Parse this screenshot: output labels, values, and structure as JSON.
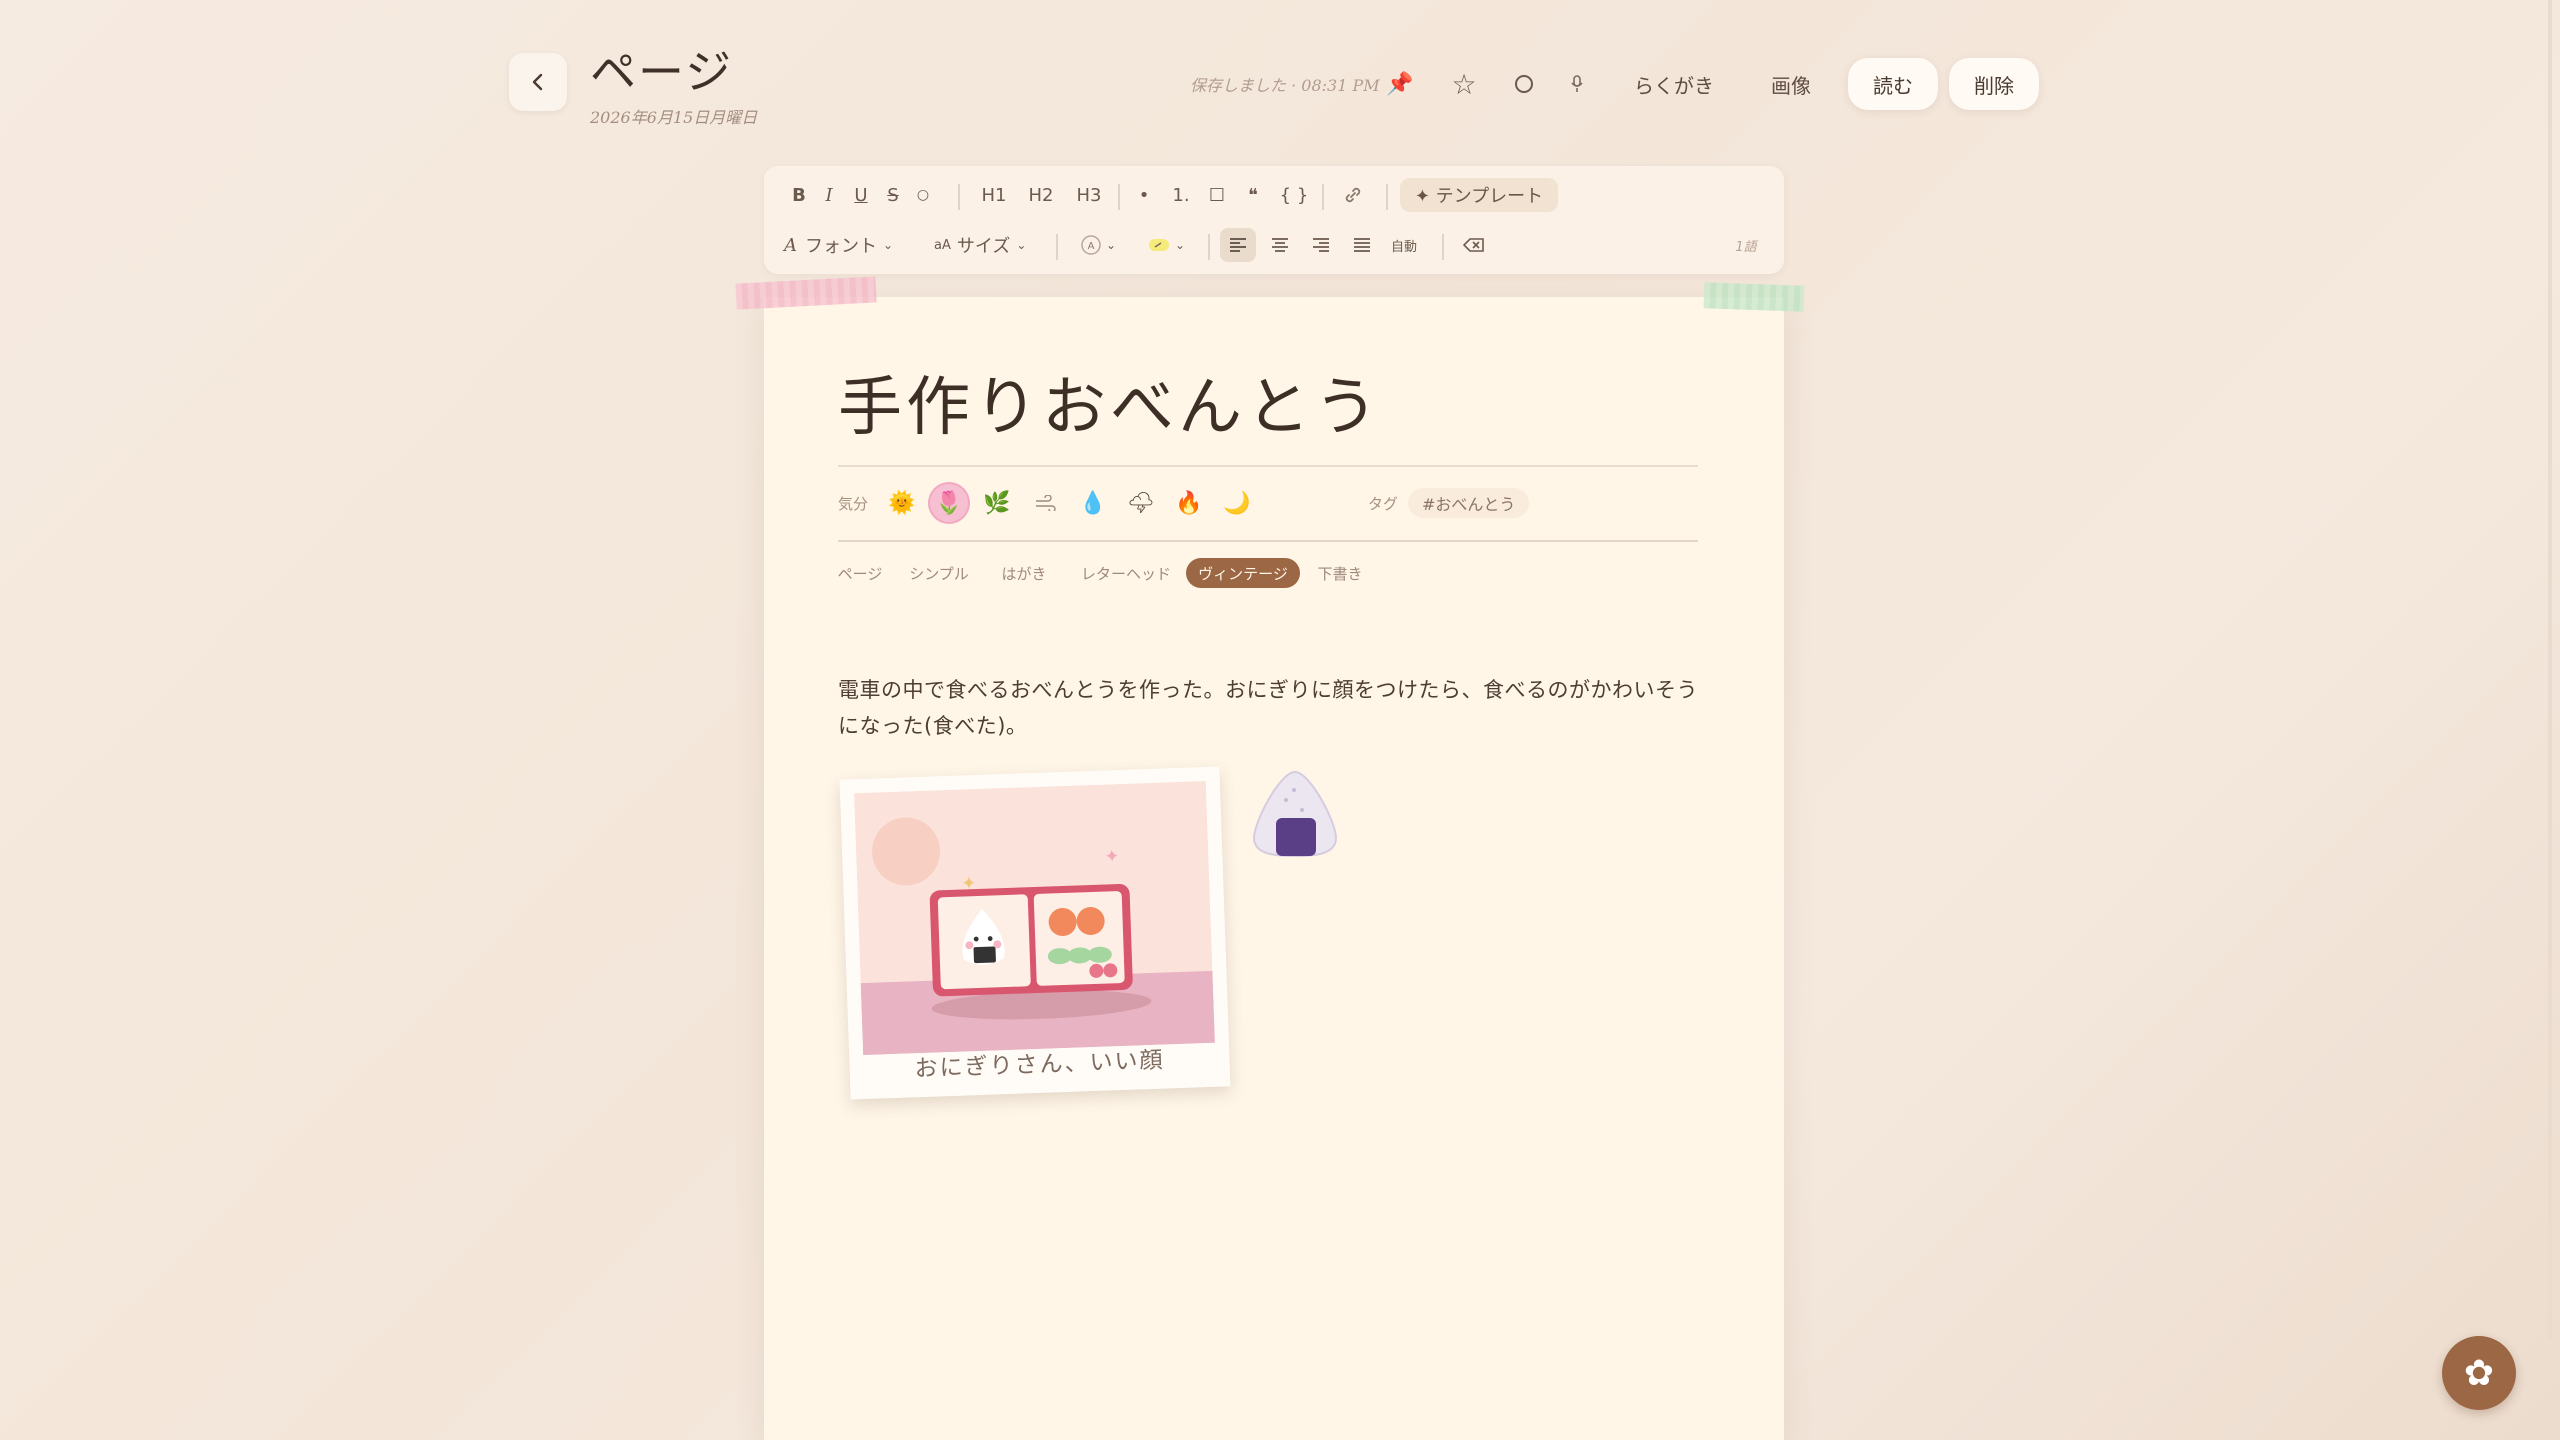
{
  "header": {
    "page_title": "ページ",
    "date": "2026年6月15日月曜日",
    "save_status": "保存しました · 08:31 PM",
    "scribble_label": "らくがき",
    "image_label": "画像",
    "read_label": "読む",
    "delete_label": "削除"
  },
  "toolbar": {
    "bold": "B",
    "italic": "I",
    "underline": "U",
    "strike": "S",
    "circle": "○",
    "h1": "H1",
    "h2": "H2",
    "h3": "H3",
    "bullet": "•",
    "numbered": "1.",
    "checkbox": "☐",
    "quote": "❝",
    "code": "{ }",
    "template": "✦ テンプレート",
    "font": "フォント",
    "size": "サイズ",
    "auto": "自動",
    "word_count": "1語"
  },
  "document": {
    "title": "手作りおべんとう",
    "mood_label": "気分",
    "tag_label": "タグ",
    "tag": "#おべんとう",
    "style_tabs": [
      "ページ",
      "シンプル",
      "はがき",
      "レターヘッド",
      "ヴィンテージ",
      "下書き"
    ],
    "active_style": "ヴィンテージ",
    "body": "電車の中で食べるおべんとうを作った。おにぎりに顔をつけたら、食べるのがかわいそうになった(食べた)。",
    "photo_caption": "おにぎりさん、いい顔"
  },
  "moods": [
    "sun",
    "flower",
    "leaf",
    "wind",
    "drop",
    "cloud",
    "fire",
    "moon"
  ],
  "colors": {
    "accent": "#9c6744",
    "paper": "#fff6e8",
    "background": "#f5e9de"
  }
}
